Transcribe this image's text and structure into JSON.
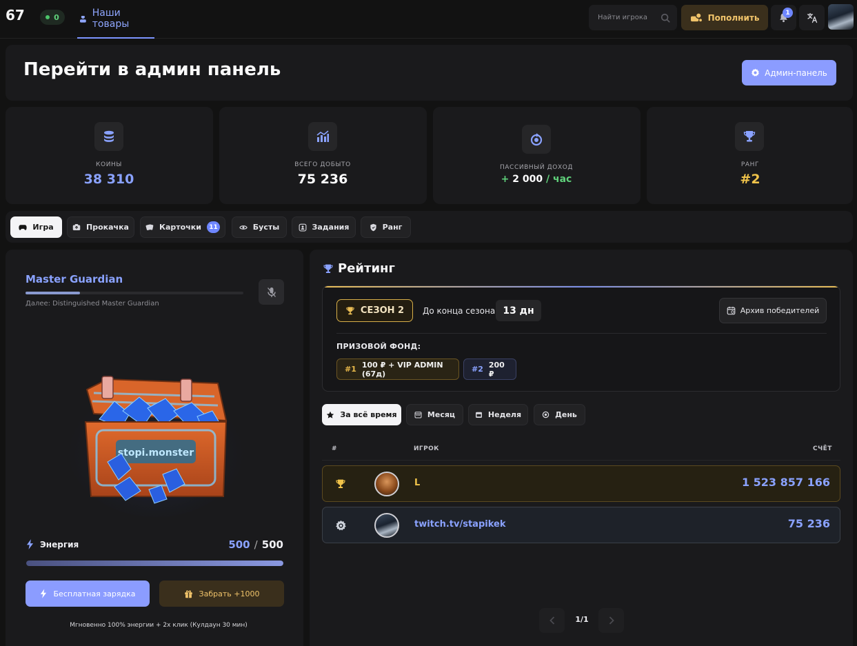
{
  "topbar": {
    "level": "67",
    "online_count": "0",
    "nav_tab": "Наши товары",
    "search_placeholder": "Найти игрока",
    "topup_label": "Пополнить",
    "notifications_count": "1"
  },
  "admin": {
    "title": "Перейти в админ панель",
    "button_label": "Админ-панель"
  },
  "stats": [
    {
      "label": "КОИНЫ",
      "value": "38 310",
      "icon": "coins-icon",
      "color": "#8aa2ff"
    },
    {
      "label": "ВСЕГО ДОБЫТО",
      "value": "75 236",
      "icon": "bar-chart-icon",
      "color": "#ffffff"
    },
    {
      "label": "ПАССИВНЫЙ ДОХОД",
      "value_prefix": "+ 2 000",
      "value_suffix": "/ час",
      "icon": "passive-income-icon",
      "color": "#5fd07a"
    },
    {
      "label": "РАНГ",
      "value": "#2",
      "icon": "trophy-icon",
      "color": "#f0c34a"
    }
  ],
  "tabs": [
    {
      "label": "Игра",
      "active": true
    },
    {
      "label": "Прокачка"
    },
    {
      "label": "Карточки",
      "count": "11"
    },
    {
      "label": "Бусты"
    },
    {
      "label": "Задания"
    },
    {
      "label": "Ранг"
    }
  ],
  "game": {
    "rank_name": "Master Guardian",
    "rank_progress": 0.25,
    "next_rank": "Далее: Distinguished Master Guardian",
    "chest_label": "stopi.monster",
    "energy_label": "Энергия",
    "energy_current": "500",
    "energy_max": "500",
    "energy_fraction": 1.0,
    "charge_label": "Бесплатная зарядка",
    "claim_label": "Забрать +1000",
    "charge_note": "Мгновенно 100% энергии + 2х клик (Кулдаун 30 мин)"
  },
  "rating": {
    "title": "Рейтинг",
    "season_label": "СЕЗОН 2",
    "season_end_label": "До конца сезона:",
    "season_days": "13 дн",
    "archive_label": "Архив победителей",
    "prize_label": "ПРИЗОВОЙ ФОНД:",
    "prizes": [
      {
        "pos": "#1",
        "text": "100 ₽ + VIP ADMIN (67д)"
      },
      {
        "pos": "#2",
        "text": "200 ₽"
      }
    ],
    "periods": [
      {
        "label": "За всё время",
        "active": true
      },
      {
        "label": "Месяц"
      },
      {
        "label": "Неделя"
      },
      {
        "label": "День"
      }
    ],
    "columns": {
      "rank": "#",
      "player": "ИГРОК",
      "score": "СЧЁТ"
    },
    "rows": [
      {
        "name": "L",
        "score": "1 523 857 166",
        "name_color": "#f0c34a"
      },
      {
        "name": "twitch.tv/stapikek",
        "score": "75 236",
        "name_color": "#8aa2ff"
      }
    ],
    "page_info": "1/1"
  }
}
